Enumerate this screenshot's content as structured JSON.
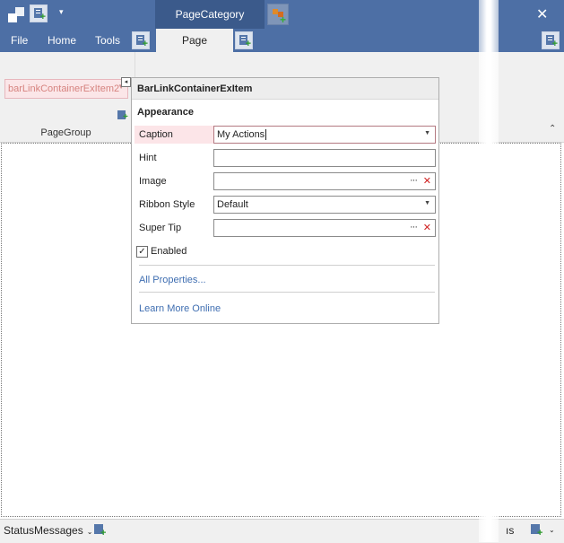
{
  "titlebar": {
    "category_tab": "PageCategory",
    "close_glyph": "✕",
    "qat_dropdown_glyph": "▾"
  },
  "tabs": {
    "file": "File",
    "home": "Home",
    "tools": "Tools",
    "page": "Page"
  },
  "ribbon": {
    "item_text": "barLinkContainerExItem2",
    "group_label": "PageGroup",
    "smart_tag_glyph": "◂",
    "collapse_glyph": "⌃"
  },
  "popup": {
    "title": "BarLinkContainerExItem",
    "section": "Appearance",
    "caption_label": "Caption",
    "caption_value": "My Actions",
    "hint_label": "Hint",
    "hint_value": "",
    "image_label": "Image",
    "image_value": "",
    "ribbon_style_label": "Ribbon Style",
    "ribbon_style_value": "Default",
    "super_tip_label": "Super Tip",
    "super_tip_value": "",
    "enabled_label": "Enabled",
    "enabled_checked": true,
    "check_glyph": "✓",
    "all_properties_link": "All Properties...",
    "learn_more_link": "Learn More Online",
    "ellipsis_glyph": "···",
    "clear_glyph": "✕",
    "dropdown_glyph": "▼"
  },
  "statusbar": {
    "left_item": "StatusMessages",
    "right_item": "ıs",
    "dropdown_glyph": "⌄"
  },
  "colors": {
    "titlebar": "#4d6fa5",
    "category_tab": "#3b5a8b",
    "ribbon_bg": "#f0f0f0",
    "selected_item_bg": "#fbe6e8",
    "link": "#3f6eb1"
  },
  "icons": {
    "app": "app-icon",
    "add_page": "add-page-icon",
    "add_category": "add-category-icon",
    "close": "close-icon"
  }
}
